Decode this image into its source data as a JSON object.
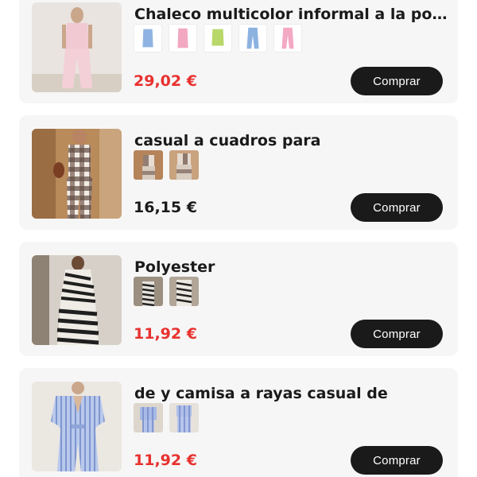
{
  "products": [
    {
      "title": "Chaleco multicolor informal a la pop...",
      "price": "29,02 €",
      "price_color": "#e8312f",
      "button": "Comprar",
      "variant_colors": [
        "#8fb4e3",
        "#f2a8c0",
        "#b8d86a",
        "#8cb2e0",
        "#f3a9c4"
      ]
    },
    {
      "title": "casual a cuadros para",
      "price": "16,15 €",
      "price_color": "#1a1a1a",
      "button": "Comprar",
      "variant_count": 2
    },
    {
      "title": "Polyester",
      "price": "11,92 €",
      "price_color": "#e8312f",
      "button": "Comprar",
      "variant_count": 2
    },
    {
      "title": "de y camisa a rayas casual de",
      "price": "11,92 €",
      "price_color": "#e8312f",
      "button": "Comprar",
      "variant_count": 2
    }
  ]
}
